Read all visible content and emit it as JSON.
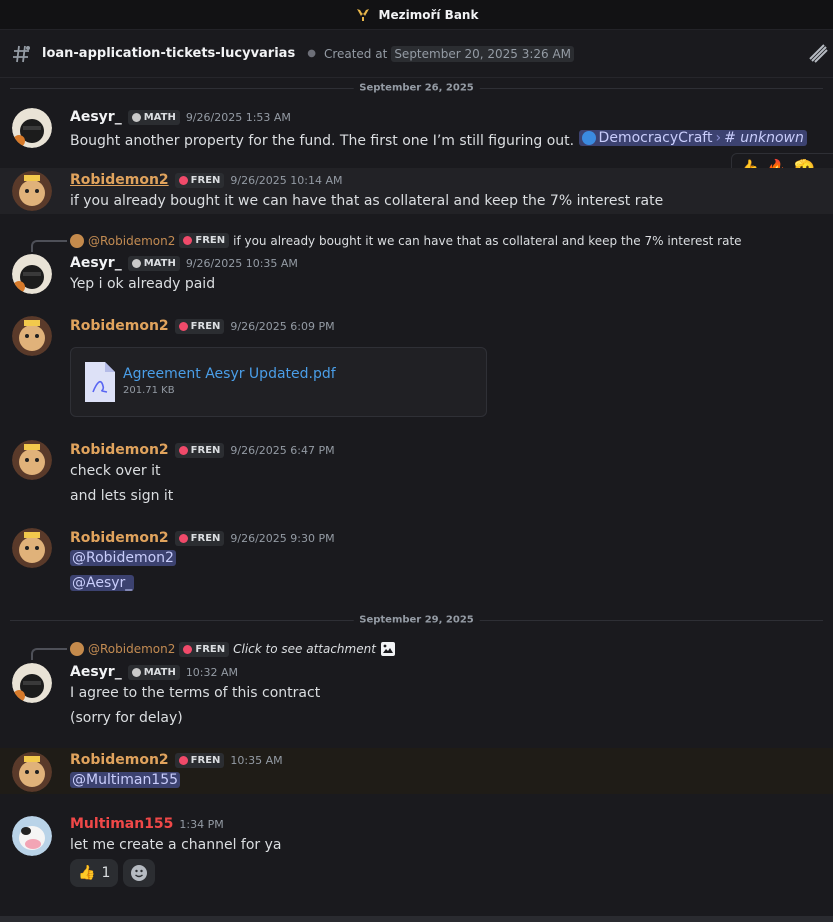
{
  "window": {
    "server_name": "Mezimoří Bank"
  },
  "channel": {
    "name": "loan-application-tickets-lucyvarias",
    "created_label": "Created at",
    "created_date": "September 20, 2025 3:26 AM"
  },
  "dividers": [
    "September 26, 2025",
    "September 29, 2025"
  ],
  "tags": {
    "math": "MATH",
    "fren": "FREN"
  },
  "users": {
    "aesyr": "Aesyr_",
    "robi": "Robidemon2",
    "multi": "Multiman155"
  },
  "messages": [
    {
      "time": "9/26/2025 1:53 AM",
      "text": "Bought another property for the fund. The first one I’m still figuring out.",
      "channel_pill": "DemocracyCraft",
      "channel_sub": "# unknown"
    },
    {
      "time": "9/26/2025 10:14 AM",
      "text": "if you already bought it we can have that as collateral and keep the 7% interest rate"
    },
    {
      "reply_user": "@Robidemon2",
      "reply_text": "if you already bought it we can have that as collateral and keep the 7% interest rate",
      "time": "9/26/2025 10:35 AM",
      "text": "Yep i ok already paid"
    },
    {
      "time": "9/26/2025 6:09 PM",
      "file_name": "Agreement Aesyr Updated.pdf",
      "file_size": "201.71 KB"
    },
    {
      "time": "9/26/2025 6:47 PM",
      "line1": "check over it",
      "line2": "and lets sign it"
    },
    {
      "time": "9/26/2025 9:30 PM",
      "mention1": "@Robidemon2",
      "mention2": "@Aesyr_"
    },
    {
      "reply_user": "@Robidemon2",
      "reply_text": "Click to see attachment",
      "time": "10:32 AM",
      "line1": "I agree to the terms of this contract",
      "line2": "(sorry for delay)"
    },
    {
      "time": "10:35 AM",
      "mention1": "@Multiman155"
    },
    {
      "time": "1:34 PM",
      "text": "let me create a channel for ya",
      "reaction_emoji": "👍",
      "reaction_count": "1"
    }
  ],
  "hover_reactions": [
    "👍",
    "🔥",
    "🫡"
  ]
}
